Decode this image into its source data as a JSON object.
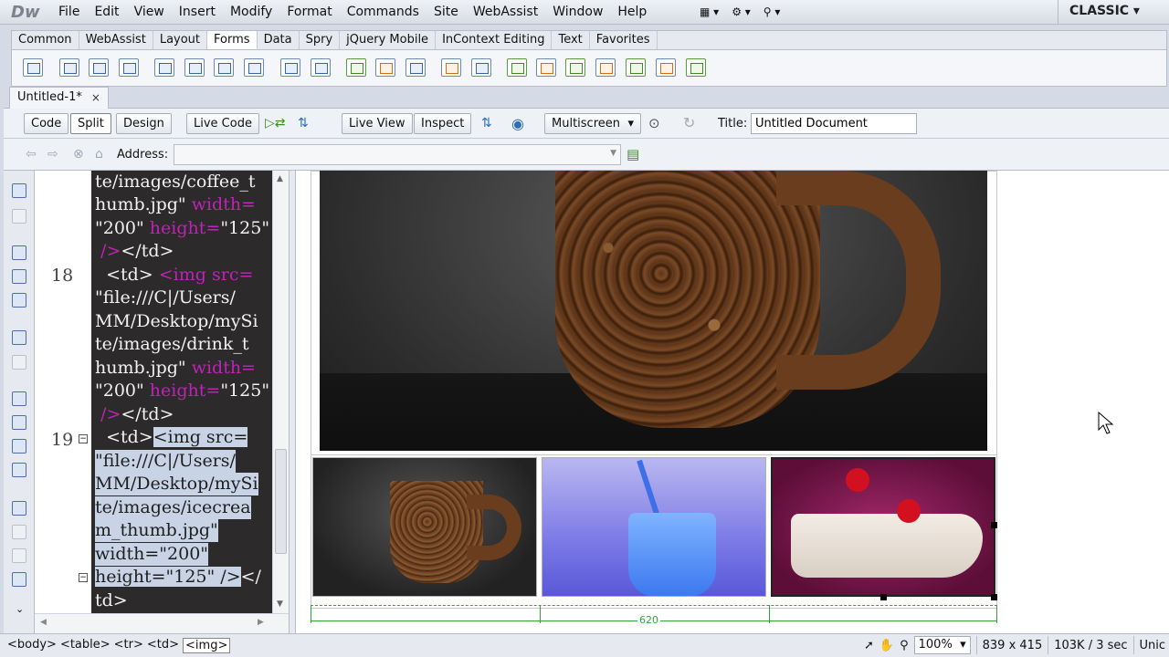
{
  "app": {
    "logo": "Dw",
    "workspace": "CLASSIC"
  },
  "menu": [
    "File",
    "Edit",
    "View",
    "Insert",
    "Modify",
    "Format",
    "Commands",
    "Site",
    "WebAssist",
    "Window",
    "Help"
  ],
  "insert_tabs": [
    "Common",
    "WebAssist",
    "Layout",
    "Forms",
    "Data",
    "Spry",
    "jQuery Mobile",
    "InContext Editing",
    "Text",
    "Favorites"
  ],
  "active_insert_tab": "Forms",
  "document_tab": {
    "name": "Untitled-1*",
    "close": "×"
  },
  "doc_toolbar": {
    "code": "Code",
    "split": "Split",
    "design": "Design",
    "live_code": "Live Code",
    "live_view": "Live View",
    "inspect": "Inspect",
    "multiscreen": "Multiscreen",
    "title_label": "Title:",
    "title_value": "Untitled Document"
  },
  "address_label": "Address:",
  "line_numbers": {
    "l18": "18",
    "l19": "19"
  },
  "code_lines": {
    "c1": "te/images/coffee_t",
    "c2a": "humb.jpg\" ",
    "c2b": "width=",
    "c3a": "\"200\" ",
    "c3b": "height=",
    "c3c": "\"125\"",
    "c4a": " />",
    "c4b": "</td>",
    "c5a": "  <td> ",
    "c5b": "<img src=",
    "c6": "\"file:///C|/Users/",
    "c7": "MM/Desktop/mySi",
    "c8": "te/images/drink_t",
    "c9a": "humb.jpg\" ",
    "c9b": "width=",
    "c10a": "\"200\" ",
    "c10b": "height=",
    "c10c": "\"125\"",
    "c11a": " />",
    "c11b": "</td>",
    "c12a": "  <td>",
    "c12b": "<img src=",
    "c13": "\"file:///C|/Users/",
    "c14": "MM/Desktop/mySi",
    "c15": "te/images/icecrea",
    "c16": "m_thumb.jpg\"",
    "c17": "width=\"200\"",
    "c18a": "height=\"125\" />",
    "c18b": "</",
    "c19": "td>"
  },
  "table_width_label": "620",
  "status": {
    "tags": [
      "<body>",
      "<table>",
      "<tr>",
      "<td>",
      "<img>"
    ],
    "zoom": "100%",
    "dimensions": "839 x 415",
    "size": "103K / 3 sec",
    "encoding": "Unic"
  }
}
